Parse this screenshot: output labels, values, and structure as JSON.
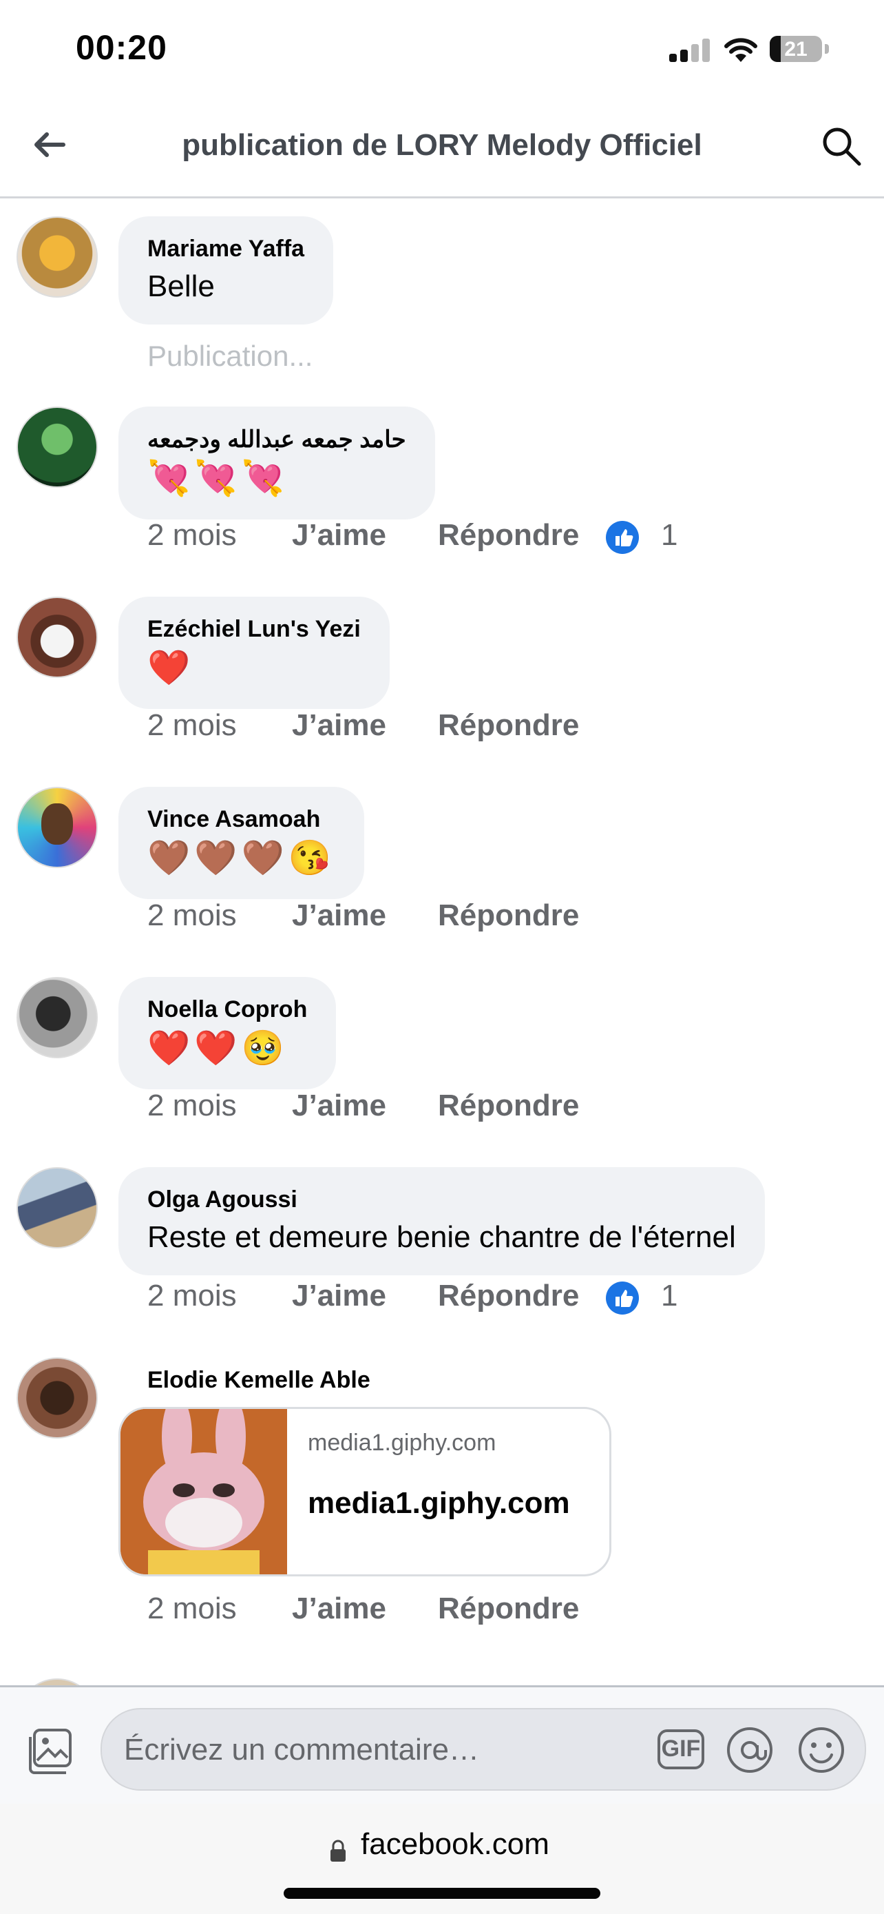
{
  "status_bar": {
    "time": "00:20",
    "battery_level": "21",
    "battery_fraction": 0.21
  },
  "header": {
    "title": "publication de LORY Melody Officiel",
    "back_icon": "back-arrow-icon",
    "search_icon": "search-icon"
  },
  "pending_label": "Publication...",
  "comments": [
    {
      "author": "Mariame Yaffa",
      "text": "Belle"
    },
    {
      "author": "حامد جمعه عبدالله ودجمعه",
      "text": "💘💘💘",
      "age": "2 mois",
      "like": "J’aime",
      "reply": "Répondre",
      "like_count": "1"
    },
    {
      "author": "Ezéchiel Lun's Yezi",
      "text": "❤️",
      "age": "2 mois",
      "like": "J’aime",
      "reply": "Répondre"
    },
    {
      "author": "Vince Asamoah",
      "text": "🤎🤎🤎😘",
      "age": "2 mois",
      "like": "J’aime",
      "reply": "Répondre"
    },
    {
      "author": "Noella Coproh",
      "text": "❤️❤️🥹",
      "age": "2 mois",
      "like": "J’aime",
      "reply": "Répondre"
    },
    {
      "author": "Olga Agoussi",
      "text": "Reste et demeure benie chantre de l'éternel",
      "age": "2 mois",
      "like": "J’aime",
      "reply": "Répondre",
      "like_count": "1"
    },
    {
      "author": "Elodie Kemelle Able",
      "link_domain": "media1.giphy.com",
      "link_title": "media1.giphy.com",
      "age": "2 mois",
      "like": "J’aime",
      "reply": "Répondre"
    }
  ],
  "composer": {
    "placeholder": "Écrivez un commentaire…",
    "gif_label": "GIF"
  },
  "browser": {
    "url": "facebook.com"
  }
}
